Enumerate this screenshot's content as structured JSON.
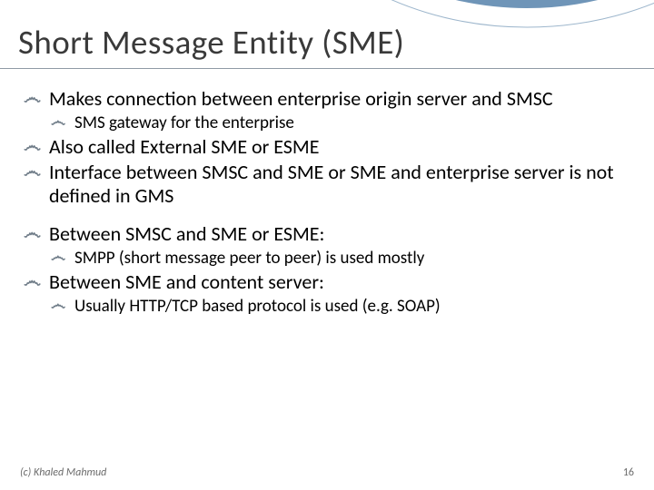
{
  "title": "Short Message Entity (SME)",
  "bullets": {
    "b1": "Makes connection between enterprise origin server and SMSC",
    "b1a": "SMS gateway for the enterprise",
    "b2": "Also called External SME or ESME",
    "b3": "Interface between SMSC and SME or SME and enterprise server is not defined in GMS",
    "b4": "Between SMSC and SME or ESME:",
    "b4a": "SMPP (short message peer to peer) is used mostly",
    "b5": "Between SME and content server:",
    "b5a": "Usually HTTP/TCP based protocol is used (e.g. SOAP)"
  },
  "footer": {
    "left": "(c) Khaled Mahmud",
    "right": "16"
  }
}
